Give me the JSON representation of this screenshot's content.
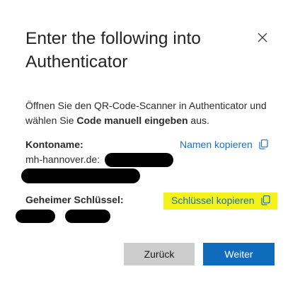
{
  "dialog": {
    "title": "Enter the following into Authenticator",
    "instructions_prefix": "Öffnen Sie den QR-Code-Scanner in Authenticator und wählen Sie ",
    "instructions_bold": "Code manuell eingeben",
    "instructions_suffix": " aus."
  },
  "account": {
    "label": "Kontoname:",
    "value_line1": "mh-hannover.de:",
    "value_line2": "",
    "copy_label": "Namen kopieren"
  },
  "secret": {
    "label": "Geheimer Schlüssel:",
    "value": "",
    "copy_label": "Schlüssel kopieren",
    "highlight_color": "#f3f31a"
  },
  "buttons": {
    "back_label": "Zurück",
    "next_label": "Weiter"
  },
  "colors": {
    "accent": "#0f6cbd",
    "link": "#1a6fc7",
    "secondary_button": "#cccccc"
  },
  "icons": {
    "close": "close-icon",
    "copy": "copy-icon"
  }
}
